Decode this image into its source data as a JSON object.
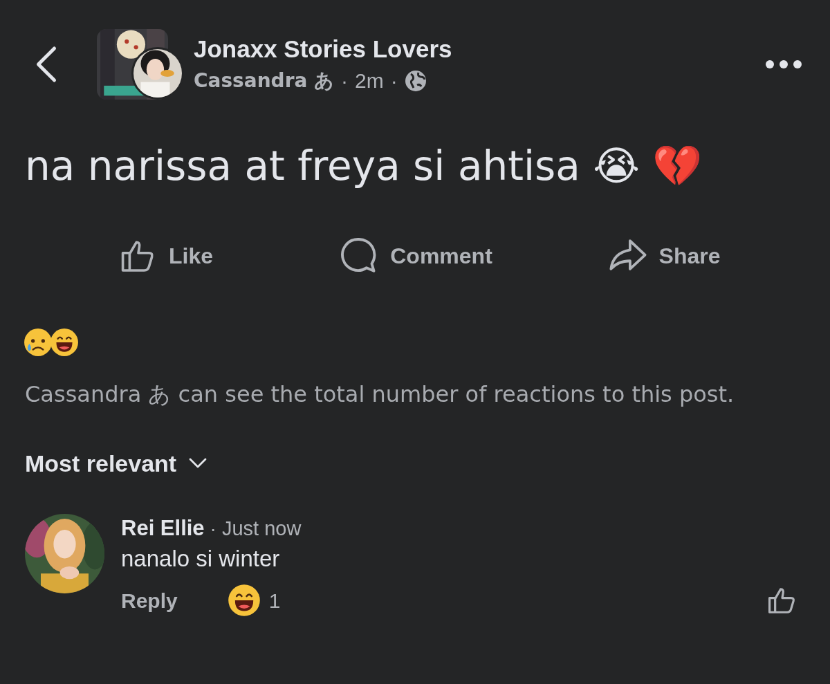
{
  "header": {
    "group_name": "Jonaxx Stories Lovers",
    "author": "Cassandra あ",
    "time": "2m",
    "separators": [
      "·",
      "·"
    ]
  },
  "post": {
    "text": "na narissa at freya si ahtisa 😭 💔"
  },
  "actions": [
    {
      "kind": "like",
      "label": "Like"
    },
    {
      "kind": "comment",
      "label": "Comment"
    },
    {
      "kind": "share",
      "label": "Share"
    }
  ],
  "reactions_notice": "Cassandra あ can see the total number of reactions to this post.",
  "sort": {
    "label": "Most relevant"
  },
  "comments": [
    {
      "author": "Rei Ellie",
      "separator": "·",
      "time": "Just now",
      "text": "nanalo si winter",
      "reply_label": "Reply",
      "reaction_count": "1"
    }
  ]
}
